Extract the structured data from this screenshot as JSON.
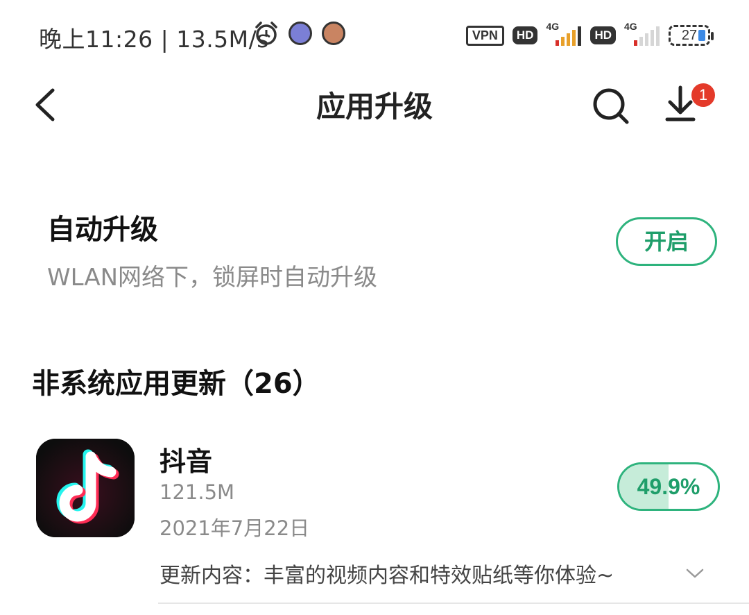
{
  "status_bar": {
    "time_text": "晚上11:26 | 13.5M/s",
    "vpn": "VPN",
    "hd1": "HD",
    "hd2": "HD",
    "net1": "4G",
    "net2": "4G",
    "battery": "27"
  },
  "header": {
    "title": "应用升级",
    "download_badge": "1"
  },
  "auto_upgrade": {
    "title": "自动升级",
    "description": "WLAN网络下，锁屏时自动升级",
    "button_label": "开启"
  },
  "section": {
    "title": "非系统应用更新（26）"
  },
  "apps": [
    {
      "name": "抖音",
      "size": "121.5M",
      "date": "2021年7月22日",
      "progress_label": "49.9%",
      "progress": 0.499,
      "notes": "更新内容：丰富的视频内容和特效贴纸等你体验~"
    }
  ],
  "colors": {
    "accent": "#2eb37d",
    "accent_text": "#1f9e6a",
    "progress_fill": "#c6ecd9",
    "badge": "#e43a2a"
  },
  "icons": [
    "alarm-icon",
    "back-arrow-icon",
    "search-icon",
    "download-icon",
    "chevron-down-icon"
  ]
}
